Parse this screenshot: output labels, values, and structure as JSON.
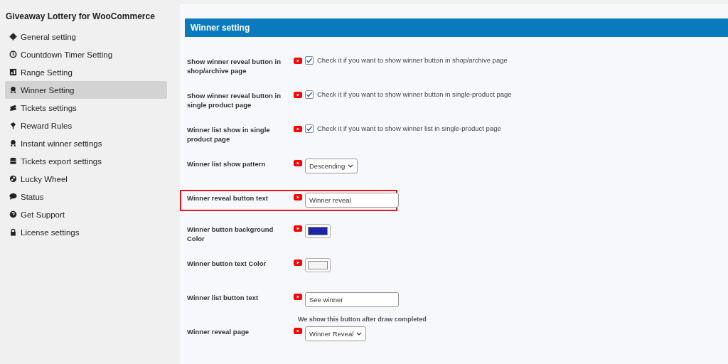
{
  "sidebar": {
    "title": "Giveaway Lottery for WooCommerce",
    "items": [
      {
        "label": "General setting",
        "selected": false
      },
      {
        "label": "Countdown Timer Setting",
        "selected": false
      },
      {
        "label": "Range Setting",
        "selected": false
      },
      {
        "label": "Winner Setting",
        "selected": true
      },
      {
        "label": "Tickets settings",
        "selected": false
      },
      {
        "label": "Reward Rules",
        "selected": false
      },
      {
        "label": "Instant winner settings",
        "selected": false
      },
      {
        "label": "Tickets export settings",
        "selected": false
      },
      {
        "label": "Lucky Wheel",
        "selected": false
      },
      {
        "label": "Status",
        "selected": false
      },
      {
        "label": "Get Support",
        "selected": false
      },
      {
        "label": "License settings",
        "selected": false
      }
    ]
  },
  "panel": {
    "title": "Winner setting",
    "rows": [
      {
        "kind": "checkbox",
        "label": "Show winner reveal button in shop/archive page",
        "checked": true,
        "description": "Check it if you want to show winner button in shop/archive page",
        "highlighted": false
      },
      {
        "kind": "checkbox",
        "label": "Show winner reveal button in single product page",
        "checked": true,
        "description": "Check it if you want to show winner button in single-product page",
        "highlighted": false
      },
      {
        "kind": "checkbox",
        "label": "Winner list show in single product page",
        "checked": true,
        "description": "Check it if you want to show winner list in single-product page",
        "highlighted": false
      },
      {
        "kind": "select",
        "label": "Winner list show pattern",
        "value": "Descending",
        "highlighted": false
      },
      {
        "kind": "text",
        "label": "Winner reveal button text",
        "value": "Winner reveal",
        "highlighted": true
      },
      {
        "kind": "color",
        "label": "Winner button background Color",
        "color": "#1c24a8",
        "highlighted": false
      },
      {
        "kind": "color",
        "label": "Winner button text Color",
        "color": "#f4f4f4",
        "highlighted": false
      },
      {
        "kind": "text",
        "label": "Winner list button text",
        "value": "See winner",
        "note": "We show this button after draw completed",
        "highlighted": false
      },
      {
        "kind": "select",
        "label": "Winner reveal page",
        "value": "Winner Reveal",
        "highlighted": false
      }
    ]
  }
}
